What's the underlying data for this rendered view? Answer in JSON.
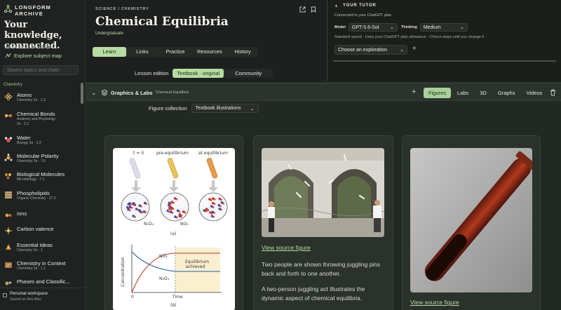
{
  "brand": {
    "name_line1": "LONGFORM",
    "name_line2": "ARCHIVE",
    "tagline": "Your knowledge, connected."
  },
  "sidebar": {
    "nearby_label": "NEARBY SUBJECTS",
    "explore_label": "Explore subject map",
    "search_placeholder": "Search topics and chats",
    "section_label": "Chemistry",
    "topics": [
      {
        "name": "Atoms",
        "sub": "Chemistry 2e · 2.3",
        "icon": "atom-icon"
      },
      {
        "name": "Chemical Bonds",
        "sub": "Anatomy and Physiology",
        "sub2": "2e · 2.2",
        "icon": "bond-icon"
      },
      {
        "name": "Water",
        "sub": "Biology 2e · 2.2",
        "icon": "water-icon"
      },
      {
        "name": "Molecular Polarity",
        "sub": "Chemistry 2e · 7.6",
        "icon": "polarity-icon"
      },
      {
        "name": "Biological Molecules",
        "sub": "Microbiology · 7.1",
        "icon": "biomolecule-icon"
      },
      {
        "name": "Phospholipids",
        "sub": "Organic Chemistry · 27.3",
        "icon": "phospholipid-icon"
      },
      {
        "name": "Ions",
        "sub": "",
        "icon": "ion-icon"
      },
      {
        "name": "Carbon valence",
        "sub": "",
        "icon": "carbon-icon"
      },
      {
        "name": "Essential Ideas",
        "sub": "Chemistry 2e · 1",
        "icon": "ideas-icon"
      },
      {
        "name": "Chemistry in Context",
        "sub": "Chemistry 2e · 1.1",
        "icon": "context-icon"
      },
      {
        "name": "Phases and Classific...",
        "sub": "",
        "icon": "phases-icon"
      }
    ],
    "workspace": {
      "title": "Personal workspace",
      "sub": "Saved on this Mac"
    }
  },
  "lesson": {
    "breadcrumb": "SCIENCE  /  CHEMISTRY",
    "title": "Chemical Equilibria",
    "level": "Undergraduate",
    "tabs": [
      "Learn",
      "Links",
      "Practice",
      "Resources",
      "History"
    ],
    "active_tab": "Learn",
    "edition_label": "Lesson edition",
    "editions": [
      "Textbook · original",
      "Community"
    ],
    "active_edition": "Textbook · original"
  },
  "tutor": {
    "title": "YOUR TUTOR",
    "status": "Connected to your ChatGPT plan",
    "model_label": "Model",
    "model_value": "GPT-5.6-Sol",
    "thinking_label": "Thinking",
    "thinking_value": "Medium",
    "note": "Standard speed · Uses your ChatGPT plan allowance · Choice stays until you change it",
    "exploration_placeholder": "Choose an exploration"
  },
  "graphics": {
    "title": "Graphics & Labs",
    "subtitle": "Chemical Equilibria",
    "tabs": [
      "Figures",
      "Labs",
      "3D",
      "Graphs",
      "Videos"
    ],
    "active_tab": "Figures",
    "collection_label": "Figure collection",
    "collection_value": "Textbook illustrations",
    "figures": [
      {
        "panel_labels": [
          "t = 0",
          "pre-equilibrium",
          "at equilibrium"
        ],
        "species_labels": [
          "N₂O₄",
          "NO₂"
        ],
        "panel_a": "(a)",
        "panel_b": "(b)",
        "graph_ylabel": "Concentration",
        "graph_xlabel": "Time",
        "graph_origin": "0",
        "graph_curve_no2": "NO₂",
        "graph_curve_n2o4": "N₂O₄",
        "graph_note_line1": "Equilibrium",
        "graph_note_line2": "achieved"
      },
      {
        "link": "View source figure",
        "caption1": "Two people are shown throwing juggling pins back and forth to one another.",
        "caption2": "A two-person juggling act illustrates the dynamic aspect of chemical equilibria."
      },
      {
        "link": "View source figure"
      }
    ]
  },
  "colors": {
    "accent": "#b7dba3",
    "background": "#1b1d1b",
    "panel": "#2a322b"
  }
}
